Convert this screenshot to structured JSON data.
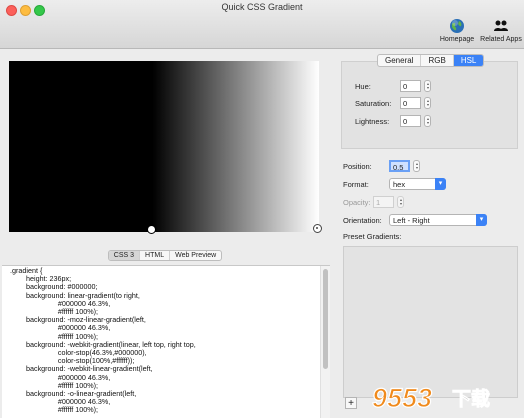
{
  "window": {
    "title": "Quick CSS Gradient"
  },
  "toolbar": {
    "homepage_label": "Homepage",
    "related_label": "Related Apps"
  },
  "preview": {
    "gradient_css": "linear-gradient(to right, #000000 46.3%, #ffffff 100%)"
  },
  "code_tabs": {
    "items": [
      "CSS 3",
      "HTML",
      "Web Preview"
    ],
    "active": "CSS 3"
  },
  "code": {
    "lines": [
      ".gradient {",
      "        height: 236px;",
      "        background: #000000;",
      "        background: linear-gradient(to right,",
      "                        #000000 46.3%,",
      "                        #ffffff 100%);",
      "        background: -moz-linear-gradient(left,",
      "                        #000000 46.3%,",
      "                        #ffffff 100%);",
      "        background: -webkit-gradient(linear, left top, right top,",
      "                        color-stop(46.3%,#000000),",
      "                        color-stop(100%,#ffffff));",
      "        background: -webkit-linear-gradient(left,",
      "                        #000000 46.3%,",
      "                        #ffffff 100%);",
      "        background: -o-linear-gradient(left,",
      "                        #000000 46.3%,",
      "                        #ffffff 100%);"
    ]
  },
  "color_tabs": {
    "items": [
      "General",
      "RGB",
      "HSL"
    ],
    "active": "HSL"
  },
  "hsl": {
    "hue_label": "Hue:",
    "hue_value": "0",
    "saturation_label": "Saturation:",
    "saturation_value": "0",
    "lightness_label": "Lightness:",
    "lightness_value": "0"
  },
  "settings": {
    "position_label": "Position:",
    "position_value": "0.5",
    "format_label": "Format:",
    "format_value": "hex",
    "opacity_label": "Opacity:",
    "opacity_value": "1",
    "orientation_label": "Orientation:",
    "orientation_value": "Left - Right",
    "presets_label": "Preset Gradients:"
  },
  "presets": {
    "add_label": "+"
  },
  "watermark": {
    "text": "9553",
    "suffix": "下载"
  },
  "colors": {
    "accent": "#3b82f6",
    "stop_1": "#000000",
    "stop_2": "#ffffff",
    "watermark_orange": "#f08a1c"
  },
  "icons": {
    "homepage": "globe-icon",
    "related": "people-icon",
    "chevron": "chevron-down-icon"
  }
}
